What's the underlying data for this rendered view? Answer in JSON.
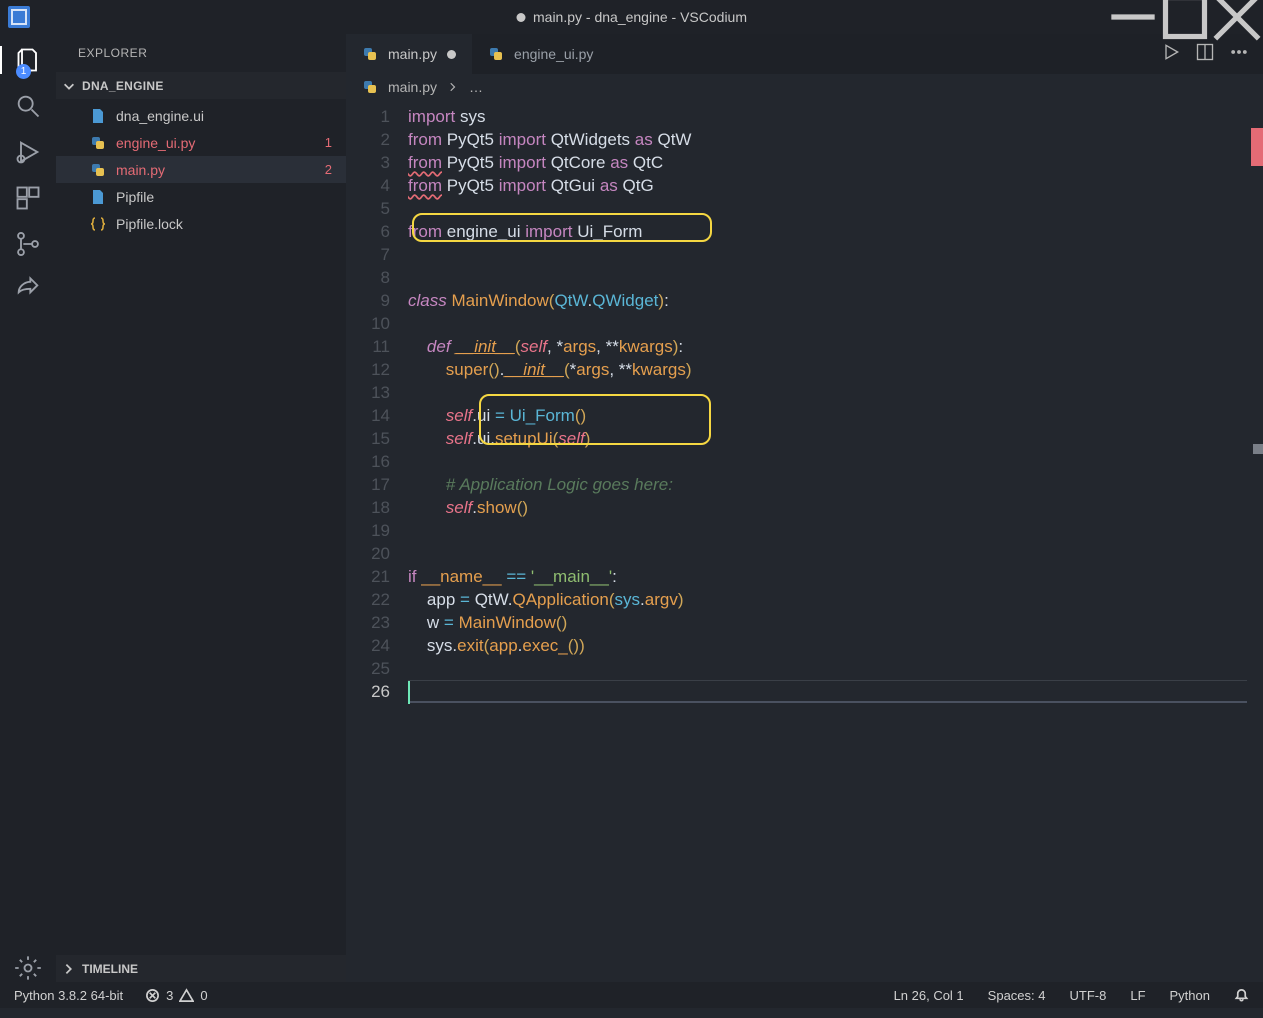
{
  "window": {
    "title": "main.py - dna_engine - VSCodium"
  },
  "activityBar": {
    "explorerBadge": "1"
  },
  "sidebar": {
    "title": "EXPLORER",
    "section": "DNA_ENGINE",
    "timeline": "TIMELINE",
    "files": [
      {
        "name": "dna_engine.ui",
        "icon": "file",
        "err": false
      },
      {
        "name": "engine_ui.py",
        "icon": "py",
        "err": true,
        "errn": "1"
      },
      {
        "name": "main.py",
        "icon": "py",
        "err": true,
        "errn": "2",
        "sel": true
      },
      {
        "name": "Pipfile",
        "icon": "file",
        "err": false
      },
      {
        "name": "Pipfile.lock",
        "icon": "lock",
        "err": false
      }
    ]
  },
  "tabs": [
    {
      "name": "main.py",
      "active": true,
      "modified": true
    },
    {
      "name": "engine_ui.py",
      "active": false,
      "modified": false
    }
  ],
  "breadcrumbs": {
    "file": "main.py",
    "more": "…"
  },
  "code": {
    "l1": "import sys",
    "l2": "from PyQt5 import QtWidgets as QtW",
    "l3": "from PyQt5 import QtCore as QtC",
    "l4": "from PyQt5 import QtGui as QtG",
    "l6": "from engine_ui import Ui_Form",
    "l9": "class MainWindow(QtW.QWidget):",
    "l11": "    def __init__(self, *args, **kwargs):",
    "l12": "        super().__init__(*args, **kwargs)",
    "l14": "        self.ui = Ui_Form()",
    "l15": "        self.ui.setupUi(self)",
    "l17": "        # Application Logic goes here:",
    "l18": "        self.show()",
    "l21": "if __name__ == '__main__':",
    "l22": "    app = QtW.QApplication(sys.argv)",
    "l23": "    w = MainWindow()",
    "l24": "    sys.exit(app.exec_())"
  },
  "status": {
    "python": "Python 3.8.2 64-bit",
    "errors": "3",
    "warnings": "0",
    "pos": "Ln 26, Col 1",
    "spaces": "Spaces: 4",
    "enc": "UTF-8",
    "eol": "LF",
    "lang": "Python"
  }
}
